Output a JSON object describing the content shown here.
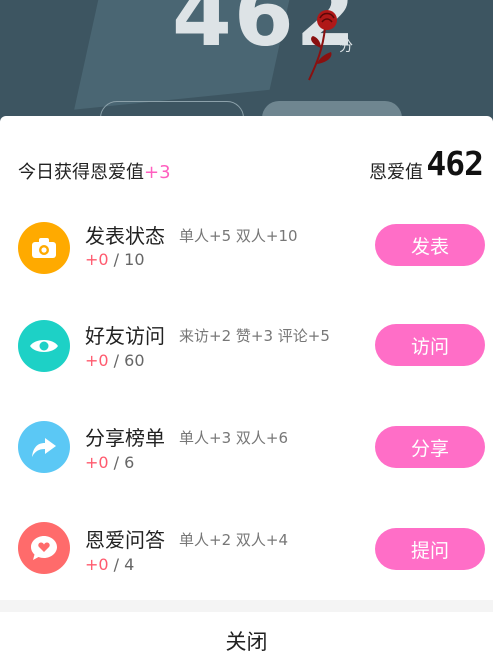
{
  "hero": {
    "score": "462",
    "unit": "分"
  },
  "header": {
    "today_label": "今日获得恩爱值",
    "today_gain": "+3",
    "total_label": "恩爱值",
    "total_value": "462"
  },
  "tasks": [
    {
      "title": "发表状态",
      "desc": "单人+5 双人+10",
      "gain": "+0",
      "progress_rest": " / 10",
      "button": "发表",
      "icon": "camera-icon",
      "color": "#ffaa00"
    },
    {
      "title": "好友访问",
      "desc": "来访+2 赞+3 评论+5",
      "gain": "+0",
      "progress_rest": " / 60",
      "button": "访问",
      "icon": "eye-icon",
      "color": "#1dd1c6"
    },
    {
      "title": "分享榜单",
      "desc": "单人+3 双人+6",
      "gain": "+0",
      "progress_rest": " / 6",
      "button": "分享",
      "icon": "share-icon",
      "color": "#5bc8f5"
    },
    {
      "title": "恩爱问答",
      "desc": "单人+2 双人+4",
      "gain": "+0",
      "progress_rest": " / 4",
      "button": "提问",
      "icon": "heart-chat-icon",
      "color": "#ff6b6b"
    }
  ],
  "footer": {
    "close_label": "关闭"
  }
}
